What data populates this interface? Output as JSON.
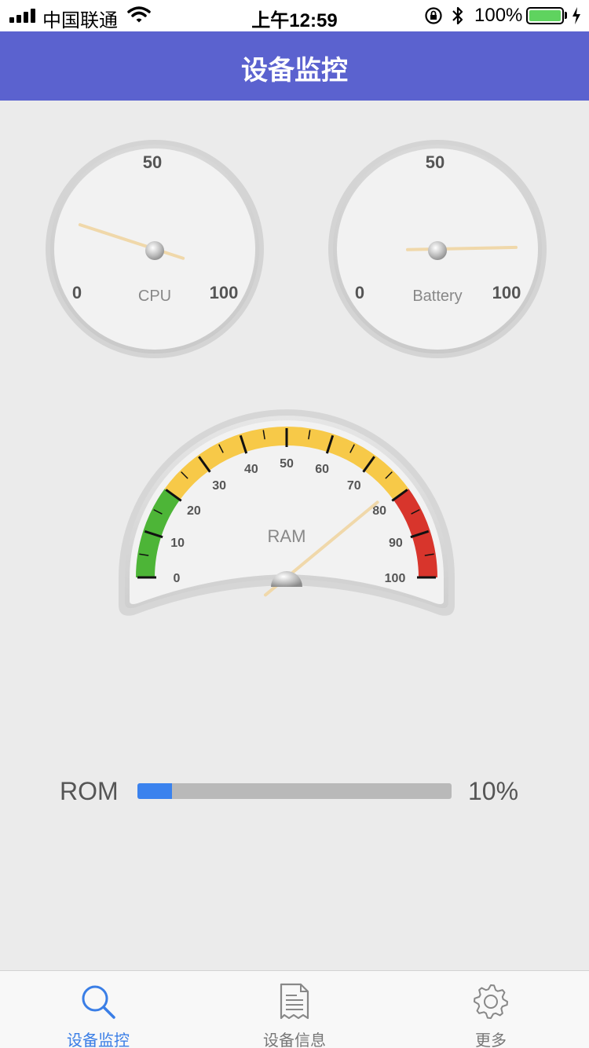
{
  "status_bar": {
    "carrier": "中国联通",
    "time": "上午12:59",
    "battery_percent": "100%",
    "battery_level": 1.0
  },
  "nav": {
    "title": "设备监控"
  },
  "gauges": {
    "cpu": {
      "label": "CPU",
      "min_label": "0",
      "mid_label": "50",
      "max_label": "100",
      "value": 20
    },
    "battery": {
      "label": "Battery",
      "min_label": "0",
      "mid_label": "50",
      "max_label": "100",
      "value": 87
    },
    "ram": {
      "label": "RAM",
      "value": 78,
      "ticks": [
        "0",
        "10",
        "20",
        "30",
        "40",
        "50",
        "60",
        "70",
        "80",
        "90",
        "100"
      ],
      "zones": [
        {
          "from": 0,
          "to": 20,
          "color": "#4db537"
        },
        {
          "from": 20,
          "to": 80,
          "color": "#f7c948"
        },
        {
          "from": 80,
          "to": 100,
          "color": "#d8352c"
        }
      ]
    }
  },
  "rom": {
    "label": "ROM",
    "percent_text": "10%",
    "fraction": 0.11
  },
  "tabs": [
    {
      "label": "设备监控",
      "icon": "search-icon",
      "active": true
    },
    {
      "label": "设备信息",
      "icon": "document-icon",
      "active": false
    },
    {
      "label": "更多",
      "icon": "gear-icon",
      "active": false
    }
  ],
  "colors": {
    "nav_bg": "#5b62cf",
    "tab_active": "#3a7ee6",
    "rom_fill": "#3a82ee"
  }
}
